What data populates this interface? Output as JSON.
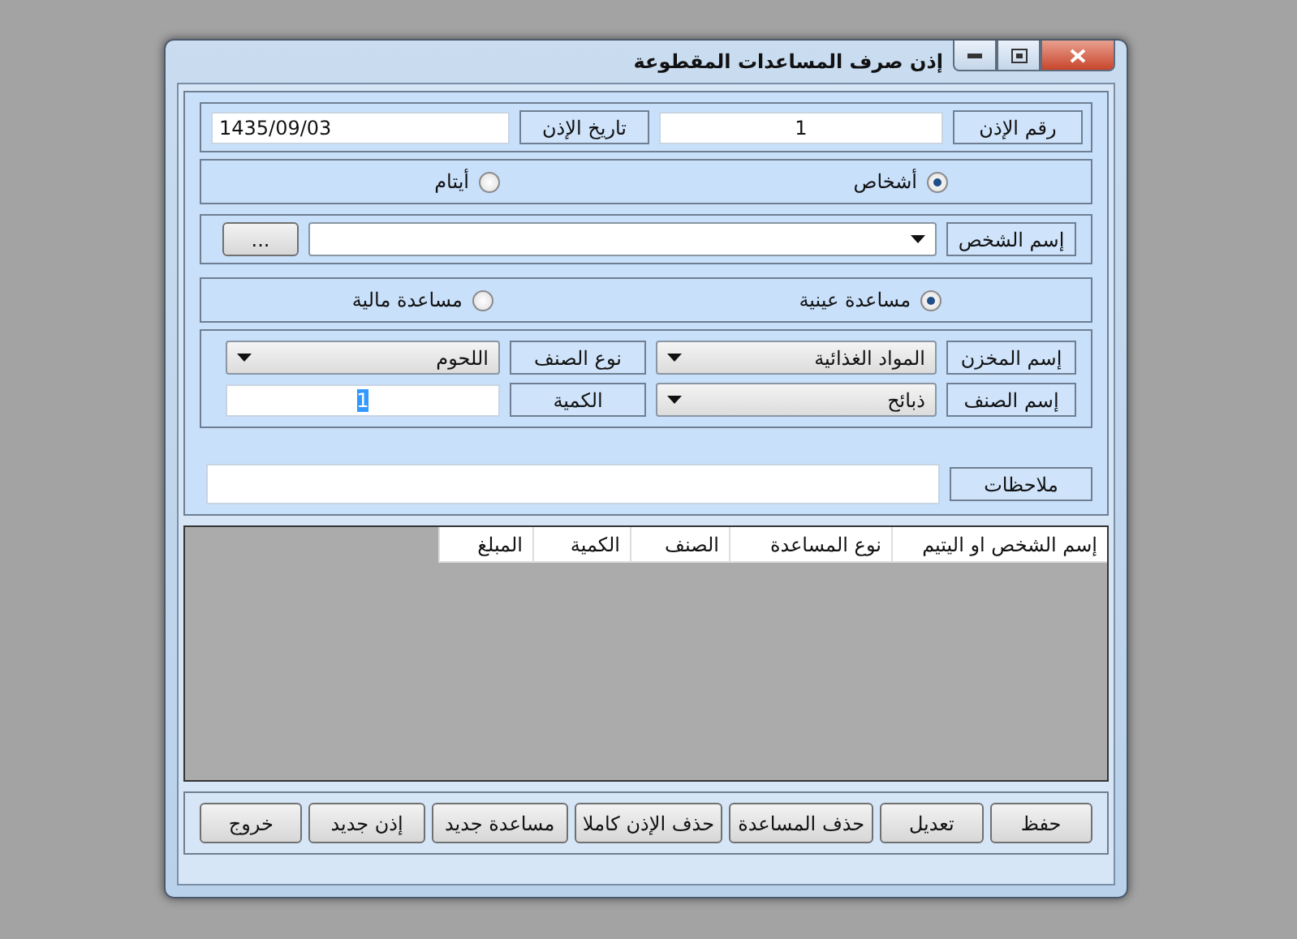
{
  "window": {
    "title": "إذن صرف المساعدات المقطوعة"
  },
  "permit_number": {
    "label": "رقم الإذن",
    "value": "1"
  },
  "permit_date": {
    "label": "تاريخ الإذن",
    "value": "1435/09/03"
  },
  "beneficiary_type": [
    {
      "label": "أشخاص",
      "selected": true
    },
    {
      "label": "أيتام",
      "selected": false
    }
  ],
  "person": {
    "label": "إسم الشخص",
    "browse": "..."
  },
  "aid_type": [
    {
      "label": "مساعدة عينية",
      "selected": true
    },
    {
      "label": "مساعدة مالية",
      "selected": false
    }
  ],
  "store": {
    "label": "إسم المخزن",
    "value": "المواد الغذائية"
  },
  "item_type": {
    "label": "نوع الصنف",
    "value": "اللحوم"
  },
  "item": {
    "label": "إسم الصنف",
    "value": "ذبائح"
  },
  "quantity": {
    "label": "الكمية",
    "value": "1",
    "highlighted": true
  },
  "notes": {
    "label": "ملاحظات"
  },
  "table": {
    "columns": [
      "إسم الشخص او اليتيم",
      "نوع المساعدة",
      "الصنف",
      "الكمية",
      "المبلغ"
    ]
  },
  "buttons": [
    "حفظ",
    "تعديل",
    "حذف المساعدة",
    "حذف الإذن كاملا",
    "مساعدة جديد",
    "إذن جديد",
    "خروج"
  ]
}
